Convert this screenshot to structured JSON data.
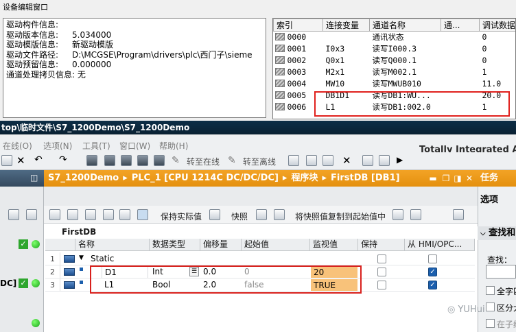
{
  "mcgs": {
    "title": "设备编辑窗口",
    "driver_info": [
      {
        "label": "驱动构件信息:",
        "value": ""
      },
      {
        "label": "驱动版本信息:",
        "value": "5.034000"
      },
      {
        "label": "驱动模版信息:",
        "value": "新驱动模版"
      },
      {
        "label": "驱动文件路径:",
        "value": "D:\\MCGSE\\Program\\drivers\\plc\\西门子\\sieme"
      },
      {
        "label": "驱动预留信息:",
        "value": "0.000000"
      },
      {
        "label": "通道处理拷贝信息:",
        "value": "无"
      }
    ],
    "channel_table": {
      "headers": [
        "索引",
        "连接变量",
        "通道名称",
        "通...",
        "调试数据"
      ],
      "rows": [
        {
          "index": "0000",
          "var": "",
          "name": "通讯状态",
          "ch": "",
          "debug": "0"
        },
        {
          "index": "0001",
          "var": "I0x3",
          "name": "读写I000.3",
          "ch": "",
          "debug": "0"
        },
        {
          "index": "0002",
          "var": "Q0x1",
          "name": "读写Q000.1",
          "ch": "",
          "debug": "0"
        },
        {
          "index": "0003",
          "var": "M2x1",
          "name": "读写M002.1",
          "ch": "",
          "debug": "1"
        },
        {
          "index": "0004",
          "var": "MW10",
          "name": "读写MWUB010",
          "ch": "",
          "debug": "11.0"
        },
        {
          "index": "0005",
          "var": "DB1D1",
          "name": "读写DB1:WU...",
          "ch": "",
          "debug": "20.0"
        },
        {
          "index": "0006",
          "var": "L1",
          "name": "读写DB1:002.0",
          "ch": "",
          "debug": "1"
        }
      ]
    }
  },
  "tia": {
    "window_title": "top\\临时文件\\S7_1200Demo\\S7_1200Demo",
    "brand": "Totally Integrated Aut",
    "menu": [
      "在线(O)",
      "选项(N)",
      "工具(T)",
      "窗口(W)",
      "帮助(H)"
    ],
    "toolbar": {
      "go_online": "转至在线",
      "go_offline": "转至离线"
    },
    "breadcrumb": [
      "S7_1200Demo",
      "PLC_1 [CPU 1214C DC/DC/DC]",
      "程序块",
      "FirstDB [DB1]"
    ],
    "db_toolbar": {
      "keep_actual": "保持实际值",
      "snapshot": "快照",
      "copy_snapshot": "将快照值复制到起始值中"
    },
    "db_name": "FirstDB",
    "columns": {
      "name": "名称",
      "datatype": "数据类型",
      "offset": "偏移量",
      "start": "起始值",
      "monitor": "监视值",
      "retain": "保持",
      "hmi": "从 HMI/OPC..."
    },
    "rows": [
      {
        "num": "1",
        "name": "Static",
        "datatype": "",
        "offset": "",
        "start": "",
        "monitor": "",
        "retain": false,
        "hmi": false
      },
      {
        "num": "2",
        "name": "D1",
        "datatype": "Int",
        "offset": "0.0",
        "start": "0",
        "monitor": "20",
        "retain": false,
        "hmi": true
      },
      {
        "num": "3",
        "name": "L1",
        "datatype": "Bool",
        "offset": "2.0",
        "start": "false",
        "monitor": "TRUE",
        "retain": false,
        "hmi": true
      }
    ],
    "left_label": "DC]",
    "task_pane": {
      "title": "任务",
      "subtitle": "选项",
      "find_head": "查找和",
      "find_label": "查找：",
      "options": [
        "全字匹",
        "区分大",
        "在子结"
      ]
    },
    "watermark": "YUHui"
  },
  "colors": {
    "highlight_red": "#e0201c",
    "tia_orange": "#f3a325",
    "monitor_fill": "#f8c27a",
    "titlebar_dark": "#0c2e47"
  }
}
